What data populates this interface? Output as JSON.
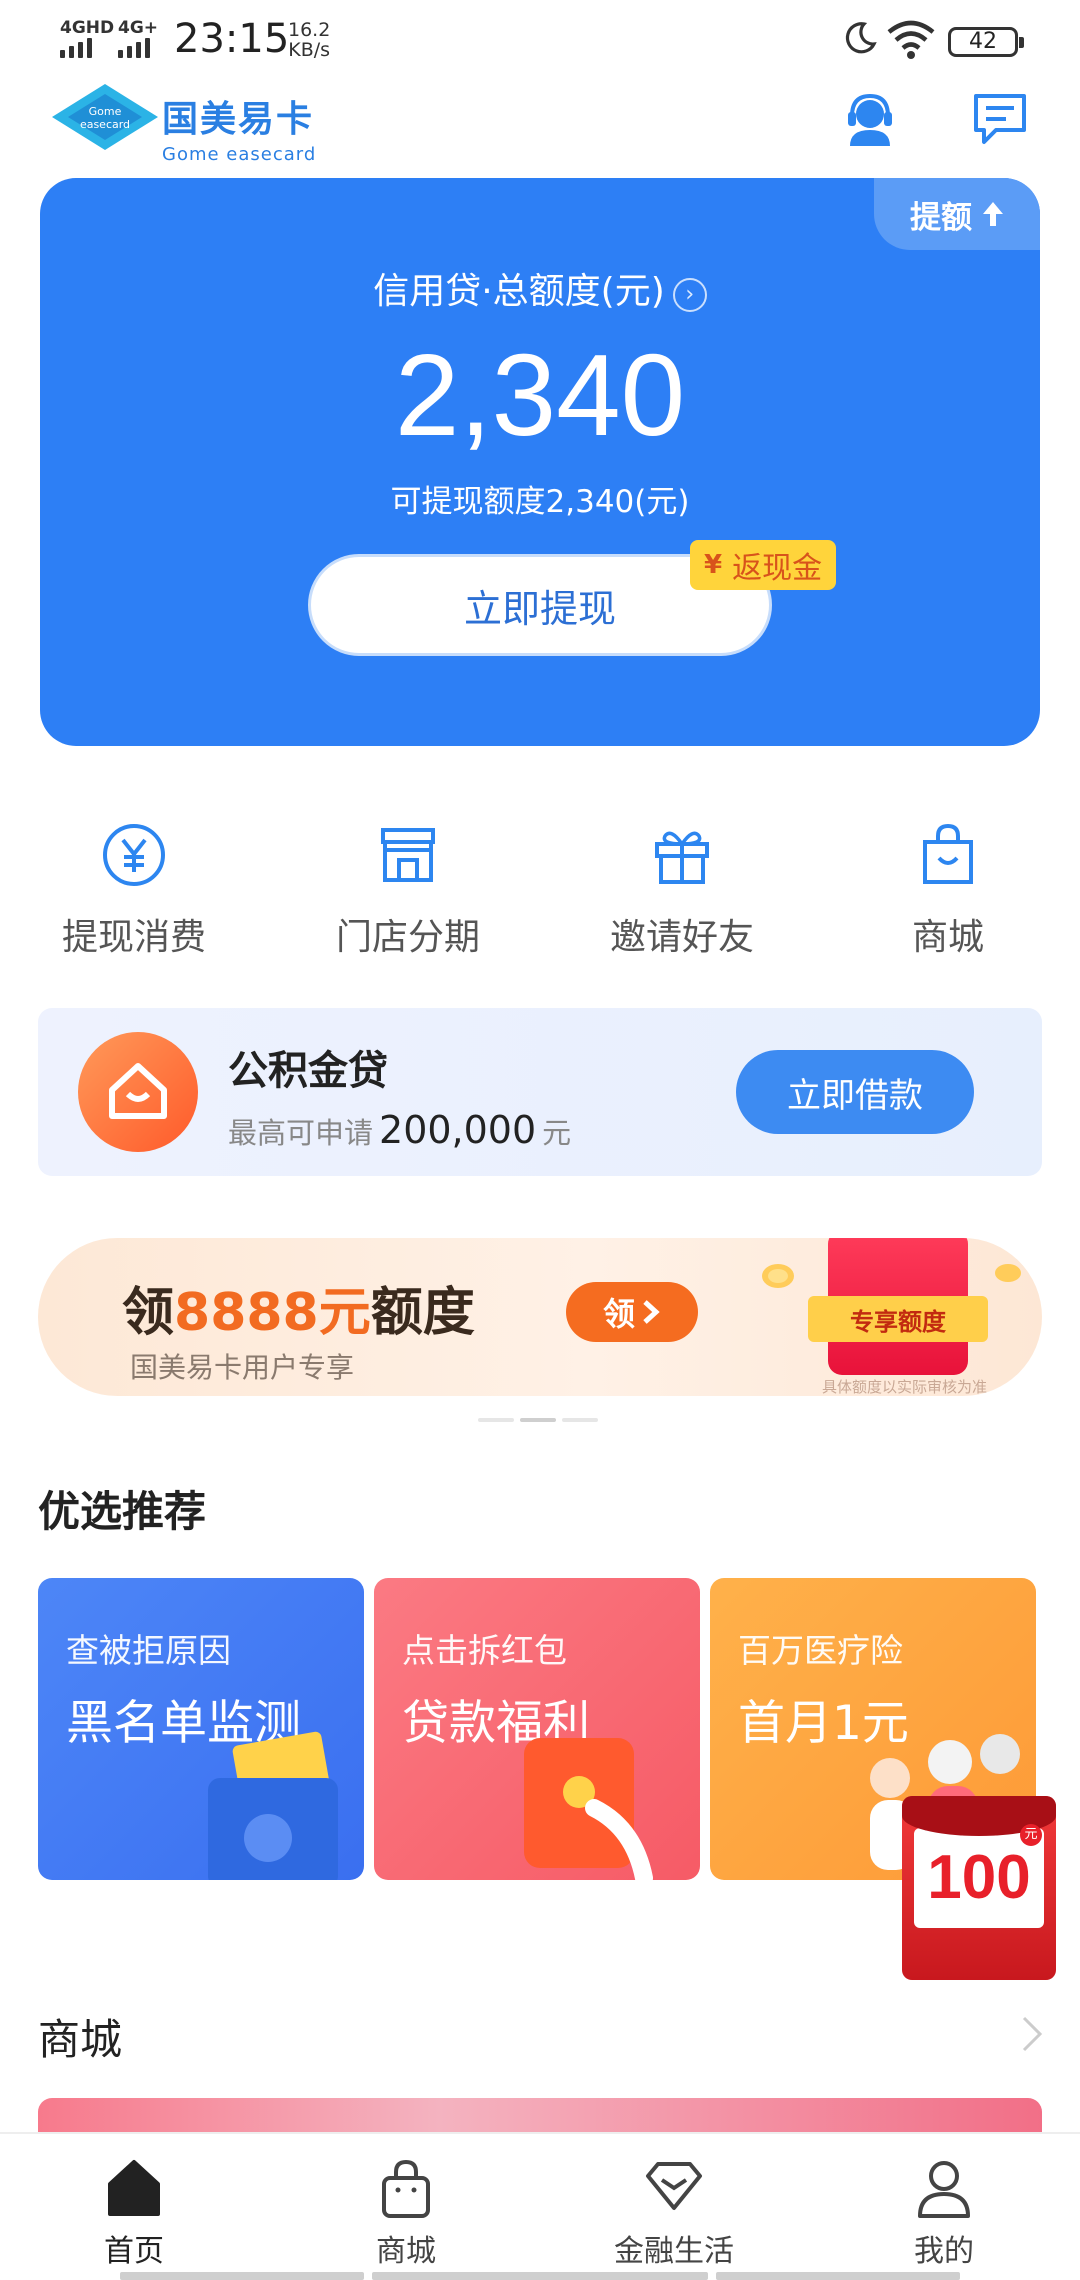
{
  "status_bar": {
    "network_1": "4GHD",
    "network_2": "4G+",
    "time": "23:15",
    "speed_value": "16.2",
    "speed_unit": "KB/s",
    "battery": "42"
  },
  "header": {
    "logo_cn": "国美易卡",
    "logo_en": "Gome easecard",
    "logo_badge": "Gome easecard",
    "icons": [
      "customer-service-icon",
      "message-icon"
    ]
  },
  "credit_card": {
    "raise_label": "提额",
    "title": "信用贷·总额度(元)",
    "amount": "2,340",
    "available": "可提现额度2,340(元)",
    "withdraw_button": "立即提现",
    "cashback_symbol": "¥",
    "cashback_label": "返现金",
    "background_color": "#2d7ff5"
  },
  "quick_menu": [
    {
      "label": "提现消费",
      "icon": "yen-icon"
    },
    {
      "label": "门店分期",
      "icon": "store-icon"
    },
    {
      "label": "邀请好友",
      "icon": "gift-icon"
    },
    {
      "label": "商城",
      "icon": "shopping-bag-icon"
    }
  ],
  "fund_loan": {
    "title": "公积金贷",
    "max_prefix": "最高可申请",
    "max_amount": "200,000",
    "max_unit": "元",
    "button": "立即借款"
  },
  "promo_banner": {
    "title_prefix": "领",
    "title_highlight": "8888元",
    "title_suffix": "额度",
    "subtitle": "国美易卡用户专享",
    "get_button": "领",
    "packet_label": "专享额度",
    "note": "具体额度以实际审核为准"
  },
  "recommend": {
    "title": "优选推荐",
    "cards": [
      {
        "sub": "查被拒原因",
        "main": "黑名单监测"
      },
      {
        "sub": "点击拆红包",
        "main": "贷款福利"
      },
      {
        "sub": "百万医疗险",
        "main": "首月1元"
      }
    ],
    "floating_redpack": {
      "value": "100",
      "unit": "元"
    }
  },
  "mall": {
    "title": "商城"
  },
  "bottom_nav": [
    {
      "label": "首页",
      "icon": "home-icon",
      "active": true
    },
    {
      "label": "商城",
      "icon": "shopping-bag-icon",
      "active": false
    },
    {
      "label": "金融生活",
      "icon": "diamond-icon",
      "active": false
    },
    {
      "label": "我的",
      "icon": "profile-icon",
      "active": false
    }
  ],
  "colors": {
    "accent": "#2d7ff5",
    "orange": "#f56c20",
    "button_blue": "#3d8bf2"
  }
}
